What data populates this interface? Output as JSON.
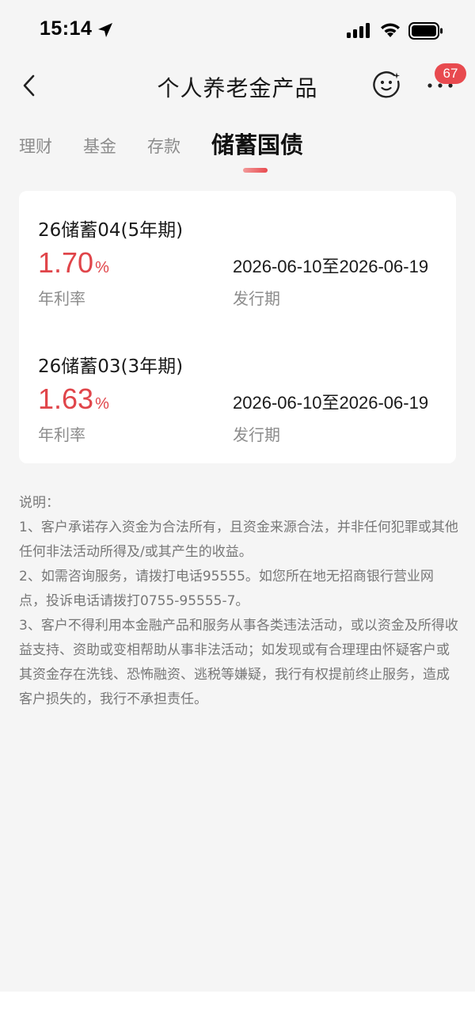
{
  "status_bar": {
    "time": "15:14",
    "icons": [
      "location-arrow-icon",
      "signal-icon",
      "wifi-icon",
      "battery-icon"
    ]
  },
  "nav": {
    "back_icon": "chevron-left-icon",
    "title": "个人养老金产品",
    "assistant_icon": "smiley-assistant-icon",
    "more_icon": "more-dots-icon",
    "badge_count": "67"
  },
  "tabs": [
    {
      "label": "理财",
      "active": false
    },
    {
      "label": "基金",
      "active": false
    },
    {
      "label": "存款",
      "active": false
    },
    {
      "label": "储蓄国债",
      "active": true
    }
  ],
  "products": [
    {
      "name": "26储蓄04(5年期)",
      "rate": "1.70",
      "rate_unit": "%",
      "rate_label": "年利率",
      "issue_period": "2026-06-10至2026-06-19",
      "period_label": "发行期"
    },
    {
      "name": "26储蓄03(3年期)",
      "rate": "1.63",
      "rate_unit": "%",
      "rate_label": "年利率",
      "issue_period": "2026-06-10至2026-06-19",
      "period_label": "发行期"
    }
  ],
  "notes": {
    "heading": "说明：",
    "items": [
      "1、客户承诺存入资金为合法所有，且资金来源合法，并非任何犯罪或其他任何非法活动所得及/或其产生的收益。",
      "2、如需咨询服务，请拨打电话95555。如您所在地无招商银行营业网点，投诉电话请拨打0755-95555-7。",
      "3、客户不得利用本金融产品和服务从事各类违法活动，或以资金及所得收益支持、资助或变相帮助从事非法活动；如发现或有合理理由怀疑客户或其资金存在洗钱、恐怖融资、逃税等嫌疑，我行有权提前终止服务，造成客户损失的，我行不承担责任。"
    ]
  },
  "colors": {
    "accent_red": "#e0454a",
    "badge_red": "#e84a4f",
    "background": "#f5f5f5",
    "muted_text": "#8c8c8c"
  }
}
